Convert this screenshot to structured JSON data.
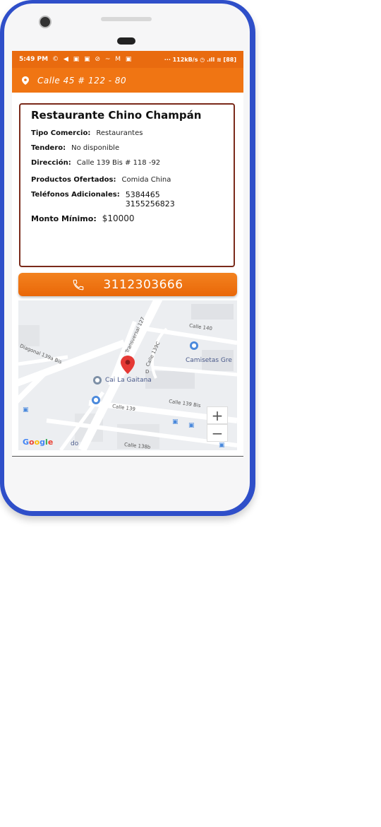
{
  "status_bar": {
    "time": "5:49 PM",
    "notification_icons": "© ◀ ▣ ▣ ⊘ ~ M ▣",
    "network_speed": "··· 112kB/s ◷ .ıll ≋ [88]"
  },
  "app_bar": {
    "address": "Calle 45 # 122 - 80",
    "icon": "location-pin-icon"
  },
  "store": {
    "name": "Restaurante Chino Champán",
    "tipo_label": "Tipo Comercio:",
    "tipo_value": "Restaurantes",
    "tendero_label": "Tendero:",
    "tendero_value": "No disponible",
    "direccion_label": "Dirección:",
    "direccion_value": "Calle 139 Bis # 118 -92",
    "productos_label": "Productos Ofertados:",
    "productos_value": "Comida China",
    "telefonos_label": "Teléfonos Adicionales:",
    "telefonos_values": [
      "5384465",
      "3155256823"
    ],
    "monto_label": "Monto Mínimo:",
    "monto_value": "$10000"
  },
  "call_button": {
    "number": "3112303666",
    "icon": "phone-icon"
  },
  "map": {
    "labels": {
      "calle_140": "Calle 140",
      "transversal_127": "Transversal 127",
      "calle_139c": "Calle 139C",
      "diagonal_139a_bis": "Diagonal 139a Bis",
      "calle_139_bis": "Calle 139 Bis",
      "calle_139": "Calle 139",
      "calle_138b": "Calle 138b",
      "d_label": "D",
      "camisetas": "Camisetas Gre",
      "cai": "Cai La Gaitana",
      "bottom_do": "do"
    },
    "zoom_in": "+",
    "zoom_out": "−",
    "google_logo": [
      "G",
      "o",
      "o",
      "g",
      "l",
      "e"
    ]
  },
  "colors": {
    "accent": "#f07513",
    "frame": "#2f4fc9",
    "card_border": "#7a2a1a",
    "marker": "#e53935"
  }
}
